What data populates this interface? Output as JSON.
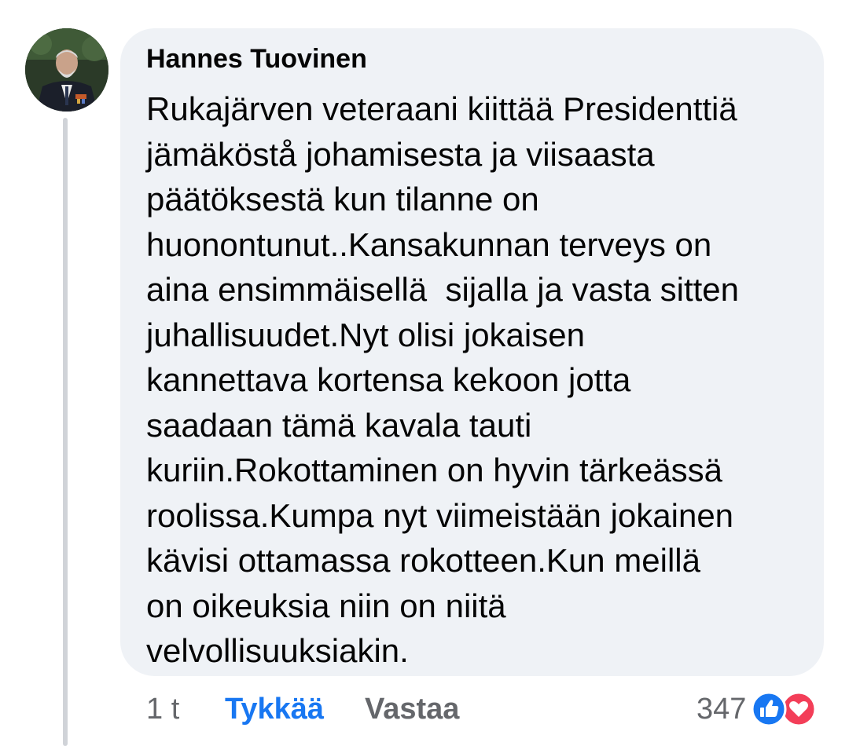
{
  "comment": {
    "author": "Hannes Tuovinen",
    "lines": [
      "Rukajärven veteraani kiittää Presidenttiä",
      "jämäköstå johamisesta ja viisaasta",
      "päätöksestä kun tilanne on",
      "huonontunut..Kansakunnan terveys on",
      "aina ensimmäisellä  sijalla ja vasta sitten",
      "juhallisuudet.Nyt olisi jokaisen",
      "kannettava kortensa kekoon jotta",
      "saadaan tämä kavala tauti",
      "kuriin.Rokottaminen on hyvin tärkeässä",
      "roolissa.Kumpa nyt viimeistään jokainen",
      "kävisi ottamassa rokotteen.Kun meillä",
      "on oikeuksia niin on niitä",
      "velvollisuuksiakin."
    ]
  },
  "actions": {
    "time": "1 t",
    "like_label": "Tykkää",
    "reply_label": "Vastaa"
  },
  "reactions": {
    "count": "347",
    "icons": [
      "like-icon",
      "love-icon"
    ]
  },
  "colors": {
    "bubble": "#eff2f6",
    "link_blue": "#1877f2",
    "secondary_text": "#65676b",
    "like_blue": "#1877f2",
    "love_red": "#f33e58"
  }
}
